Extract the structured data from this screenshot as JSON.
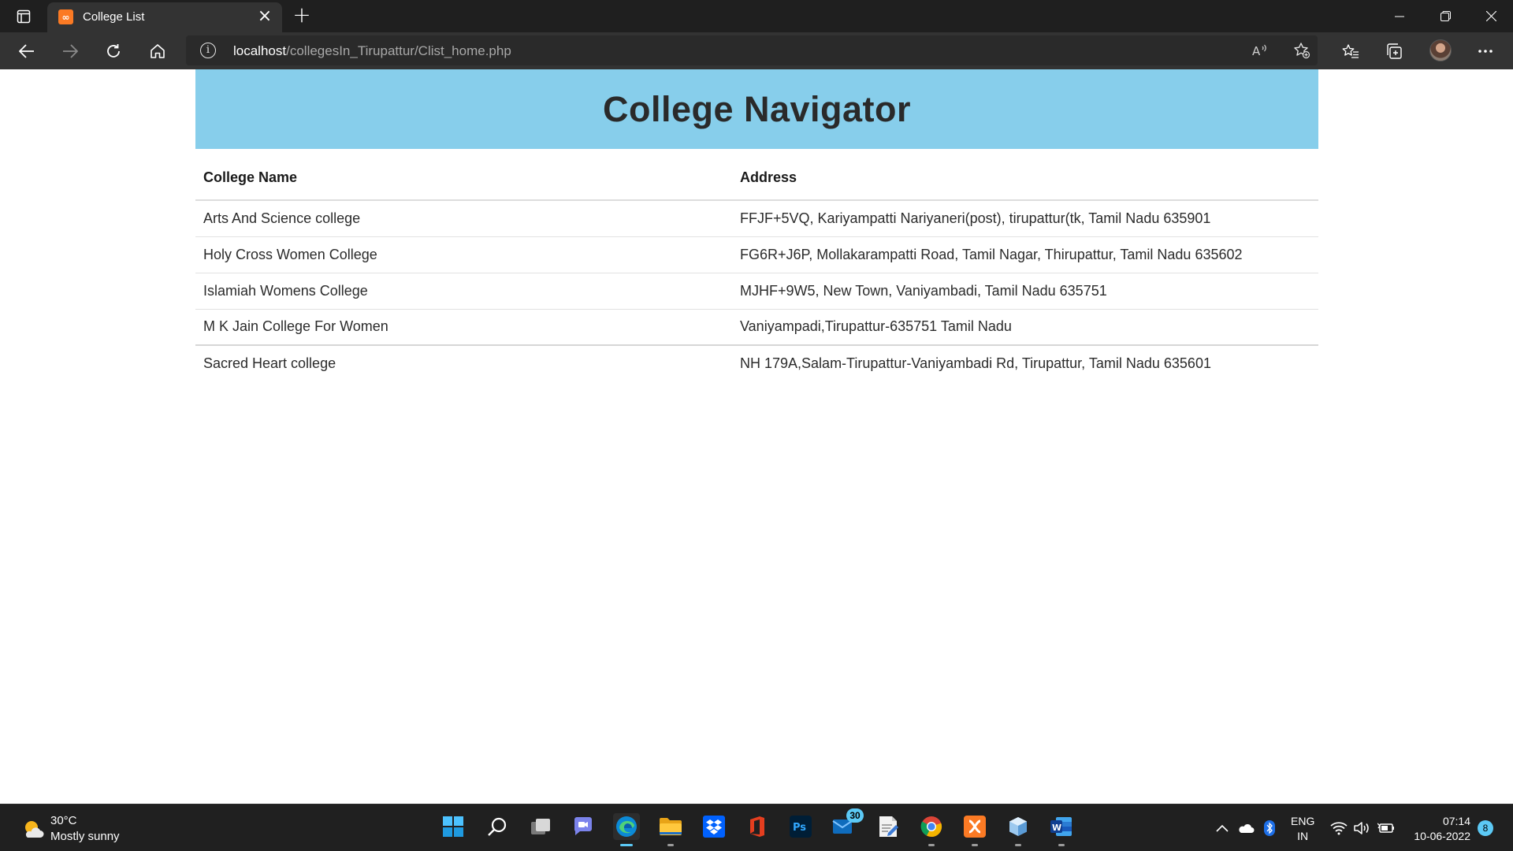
{
  "browser": {
    "tab_title": "College List",
    "tab_favicon": "xampp-icon",
    "url_host": "localhost",
    "url_path": "/collegesIn_Tirupattur/Clist_home.php"
  },
  "page": {
    "heading": "College Navigator",
    "table": {
      "headers": [
        "College Name",
        "Address"
      ],
      "rows": [
        {
          "name": "Arts And Science college",
          "address": "FFJF+5VQ, Kariyampatti Nariyaneri(post), tirupattur(tk, Tamil Nadu 635901"
        },
        {
          "name": "Holy Cross Women College",
          "address": "FG6R+J6P, Mollakarampatti Road, Tamil Nagar, Thirupattur, Tamil Nadu 635602"
        },
        {
          "name": "Islamiah Womens College",
          "address": "MJHF+9W5, New Town, Vaniyambadi, Tamil Nadu 635751"
        },
        {
          "name": "M K Jain College For Women",
          "address": "Vaniyampadi,Tirupattur-635751 Tamil Nadu"
        },
        {
          "name": "Sacred Heart college",
          "address": "NH 179A,Salam-Tirupattur-Vaniyambadi Rd, Tirupattur, Tamil Nadu 635601"
        }
      ]
    }
  },
  "taskbar": {
    "weather_temp": "30°C",
    "weather_desc": "Mostly sunny",
    "lang_line1": "ENG",
    "lang_line2": "IN",
    "time": "07:14",
    "date": "10-06-2022",
    "mail_badge": "30",
    "notification_count": "8"
  },
  "colors": {
    "header_bg": "#87ceeb",
    "chrome_dark": "#1f1f1f",
    "toolbar": "#333333",
    "taskbar": "#202020",
    "accent": "#5cc9f5"
  }
}
